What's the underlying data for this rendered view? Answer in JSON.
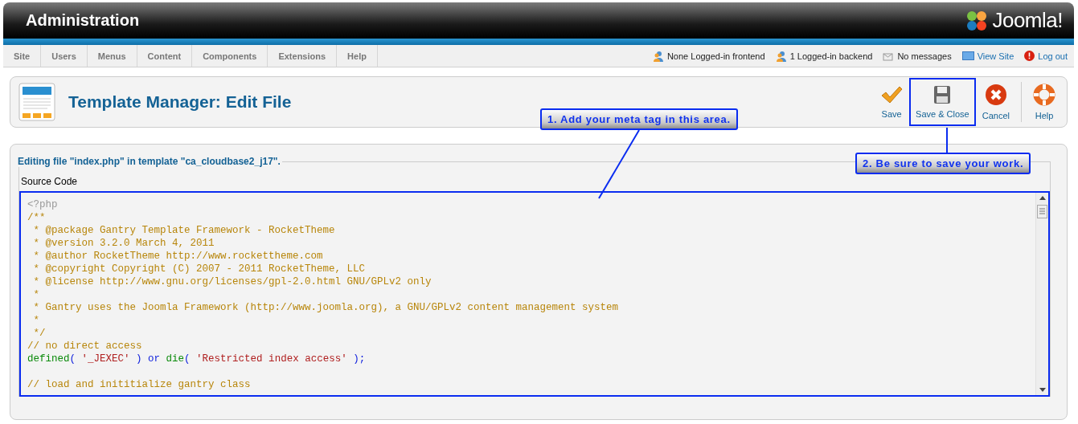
{
  "header": {
    "title": "Administration",
    "logo_text": "Joomla!"
  },
  "menu": [
    "Site",
    "Users",
    "Menus",
    "Content",
    "Components",
    "Extensions",
    "Help"
  ],
  "status": [
    {
      "kind": "frontend",
      "label": "None Logged-in frontend"
    },
    {
      "kind": "backend",
      "label": "1 Logged-in backend"
    },
    {
      "kind": "messages",
      "label": "No messages"
    },
    {
      "kind": "view-site",
      "label": "View Site"
    },
    {
      "kind": "logout",
      "label": "Log out"
    }
  ],
  "toolbar": {
    "title": "Template Manager: Edit File",
    "buttons": [
      {
        "kind": "save",
        "label": "Save",
        "highlighted": false
      },
      {
        "kind": "save-close",
        "label": "Save & Close",
        "highlighted": true
      },
      {
        "kind": "cancel",
        "label": "Cancel",
        "highlighted": false
      },
      {
        "kind": "help",
        "label": "Help",
        "highlighted": false
      }
    ]
  },
  "editor": {
    "legend": "Editing file \"index.php\" in template \"ca_cloudbase2_j17\".",
    "label": "Source Code",
    "highlighted": true,
    "lines": [
      [
        {
          "kind": "tag",
          "text": "<?php"
        }
      ],
      [
        {
          "kind": "comment",
          "text": "/**"
        }
      ],
      [
        {
          "kind": "comment",
          "text": " * @package Gantry Template Framework - RocketTheme"
        }
      ],
      [
        {
          "kind": "comment",
          "text": " * @version 3.2.0 March 4, 2011"
        }
      ],
      [
        {
          "kind": "comment",
          "text": " * @author RocketTheme http://www.rockettheme.com"
        }
      ],
      [
        {
          "kind": "comment",
          "text": " * @copyright Copyright (C) 2007 - 2011 RocketTheme, LLC"
        }
      ],
      [
        {
          "kind": "comment",
          "text": " * @license http://www.gnu.org/licenses/gpl-2.0.html GNU/GPLv2 only"
        }
      ],
      [
        {
          "kind": "comment",
          "text": " *"
        }
      ],
      [
        {
          "kind": "comment",
          "text": " * Gantry uses the Joomla Framework (http://www.joomla.org), a GNU/GPLv2 content management system"
        }
      ],
      [
        {
          "kind": "comment",
          "text": " *"
        }
      ],
      [
        {
          "kind": "comment",
          "text": " */"
        }
      ],
      [
        {
          "kind": "comment",
          "text": "// no direct access"
        }
      ],
      [
        {
          "kind": "func",
          "text": "defined"
        },
        {
          "kind": "punct",
          "text": "( "
        },
        {
          "kind": "string",
          "text": "'_JEXEC'"
        },
        {
          "kind": "punct",
          "text": " ) "
        },
        {
          "kind": "keyword",
          "text": "or "
        },
        {
          "kind": "func",
          "text": "die"
        },
        {
          "kind": "punct",
          "text": "( "
        },
        {
          "kind": "string",
          "text": "'Restricted index access'"
        },
        {
          "kind": "punct",
          "text": " );"
        }
      ],
      {
        "kind": "blank"
      },
      [
        {
          "kind": "comment",
          "text": "// load and inititialize gantry class"
        }
      ]
    ]
  },
  "callouts": [
    {
      "text": "1. Add your meta tag in this area."
    },
    {
      "text": "2. Be sure to save your work."
    }
  ]
}
